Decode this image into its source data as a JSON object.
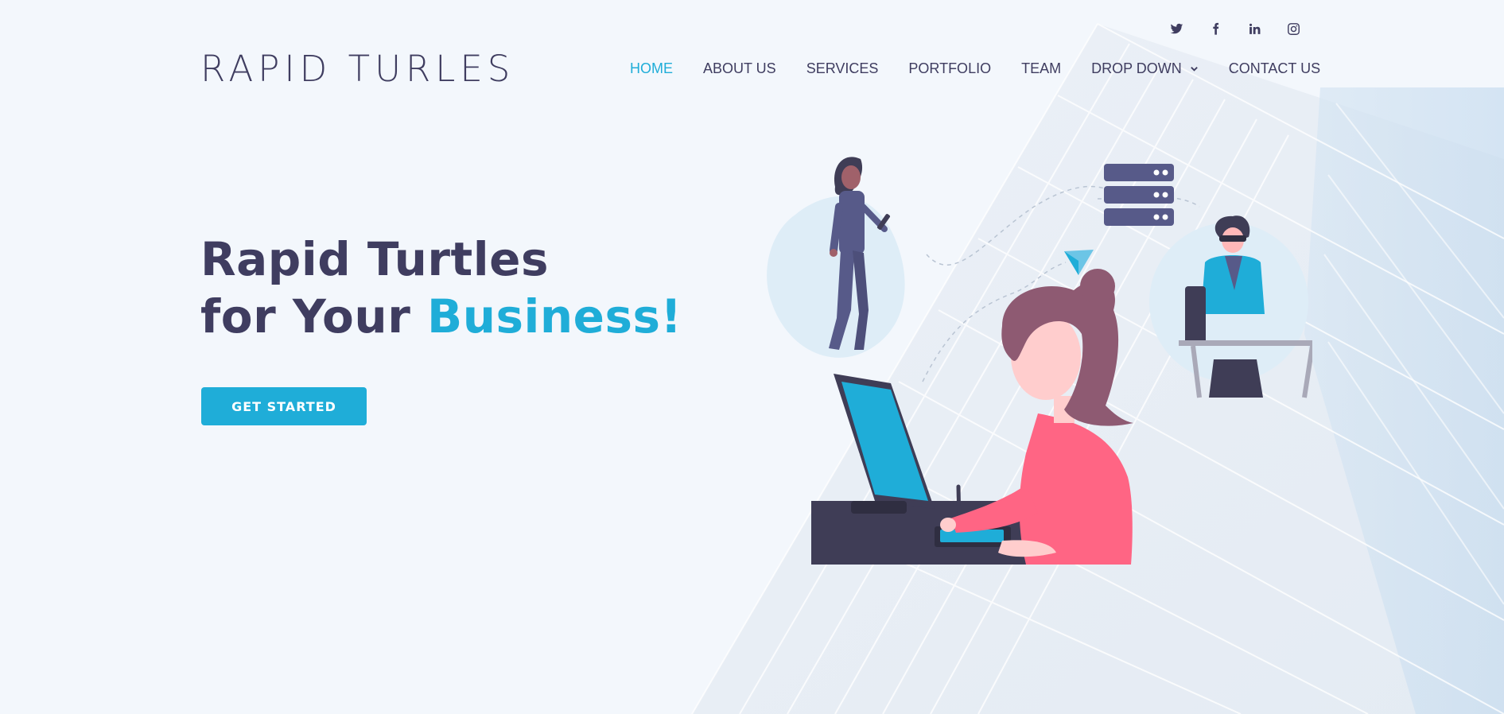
{
  "brand": {
    "logo": "RAPID TURLES"
  },
  "social": [
    {
      "icon": "twitter-icon"
    },
    {
      "icon": "facebook-icon"
    },
    {
      "icon": "linkedin-icon"
    },
    {
      "icon": "instagram-icon"
    }
  ],
  "nav": {
    "items": [
      {
        "label": "HOME",
        "active": true
      },
      {
        "label": "ABOUT US"
      },
      {
        "label": "SERVICES"
      },
      {
        "label": "PORTFOLIO"
      },
      {
        "label": "TEAM"
      },
      {
        "label": "DROP DOWN"
      },
      {
        "label": "CONTACT US"
      }
    ]
  },
  "hero": {
    "line1": "Rapid Turtles",
    "line2_prefix": "for Your ",
    "line2_accent": "Business!",
    "cta_label": "GET STARTED"
  },
  "colors": {
    "accent": "#1fadd8",
    "text": "#3f3d60",
    "background": "#f3f7fc",
    "pink": "#ff6584",
    "hair": "#8e5a72"
  }
}
